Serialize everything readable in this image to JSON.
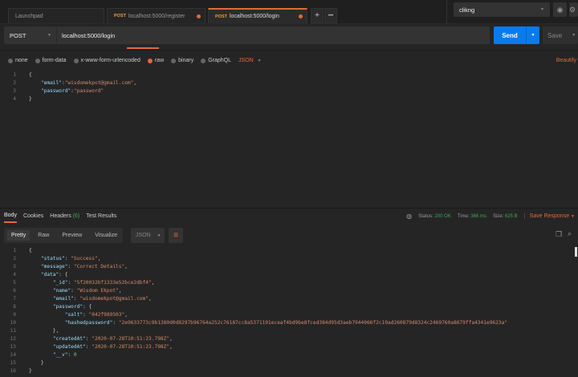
{
  "tabs": [
    {
      "label": "Launchpad"
    },
    {
      "method": "POST",
      "label": "localhost:5000/register",
      "unsaved": true
    },
    {
      "method": "POST",
      "label": "localhost:5000/login",
      "unsaved": true,
      "active": true
    }
  ],
  "tab_actions": {
    "new": "+",
    "more": "•••"
  },
  "environment": {
    "selected": "clikng"
  },
  "request": {
    "method": "POST",
    "url": "localhost:5000/login",
    "send_label": "Send",
    "save_label": "Save"
  },
  "body_options": {
    "items": [
      "none",
      "form-data",
      "x-www-form-urlencoded",
      "raw",
      "binary",
      "GraphQL"
    ],
    "selected": "raw",
    "format": "JSON",
    "beautify": "Beautify"
  },
  "request_body": [
    [
      {
        "t": "p",
        "v": "{"
      }
    ],
    [
      {
        "t": "p",
        "v": "    "
      },
      {
        "t": "k",
        "v": "\"email\""
      },
      {
        "t": "p",
        "v": ":"
      },
      {
        "t": "s",
        "v": "\"wisdomekpot@gmail.com\""
      },
      {
        "t": "p",
        "v": ","
      }
    ],
    [
      {
        "t": "p",
        "v": "    "
      },
      {
        "t": "k",
        "v": "\"password\""
      },
      {
        "t": "p",
        "v": ":"
      },
      {
        "t": "s",
        "v": "\"password\""
      }
    ],
    [
      {
        "t": "p",
        "v": "}"
      }
    ]
  ],
  "response": {
    "tabs": [
      "Body",
      "Cookies",
      "Headers",
      "Test Results"
    ],
    "headers_count": "(6)",
    "status_label": "Status:",
    "status": "200 OK",
    "time_label": "Time:",
    "time": "366 ms",
    "size_label": "Size:",
    "size": "625 B",
    "save_response": "Save Response",
    "view_modes": [
      "Pretty",
      "Raw",
      "Preview",
      "Visualize"
    ],
    "format": "JSON",
    "colors": {
      "accent": "#e4683a",
      "send": "#097bed",
      "ok": "#3fa854"
    }
  },
  "response_body": [
    [
      {
        "t": "p",
        "v": "{"
      }
    ],
    [
      {
        "t": "p",
        "v": "    "
      },
      {
        "t": "k",
        "v": "\"status\""
      },
      {
        "t": "p",
        "v": ": "
      },
      {
        "t": "s",
        "v": "\"Success\""
      },
      {
        "t": "p",
        "v": ","
      }
    ],
    [
      {
        "t": "p",
        "v": "    "
      },
      {
        "t": "k",
        "v": "\"message\""
      },
      {
        "t": "p",
        "v": ": "
      },
      {
        "t": "s",
        "v": "\"Correct Details\""
      },
      {
        "t": "p",
        "v": ","
      }
    ],
    [
      {
        "t": "p",
        "v": "    "
      },
      {
        "t": "k",
        "v": "\"data\""
      },
      {
        "t": "p",
        "v": ": {"
      }
    ],
    [
      {
        "t": "p",
        "v": "        "
      },
      {
        "t": "k",
        "v": "\"_id\""
      },
      {
        "t": "p",
        "v": ": "
      },
      {
        "t": "s",
        "v": "\"5f20032bf1333e52bce2dbf4\""
      },
      {
        "t": "p",
        "v": ","
      }
    ],
    [
      {
        "t": "p",
        "v": "        "
      },
      {
        "t": "k",
        "v": "\"name\""
      },
      {
        "t": "p",
        "v": ": "
      },
      {
        "t": "s",
        "v": "\"Wisdom Ekpot\""
      },
      {
        "t": "p",
        "v": ","
      }
    ],
    [
      {
        "t": "p",
        "v": "        "
      },
      {
        "t": "k",
        "v": "\"email\""
      },
      {
        "t": "p",
        "v": ": "
      },
      {
        "t": "s",
        "v": "\"wisdomekpot@gmail.com\""
      },
      {
        "t": "p",
        "v": ","
      }
    ],
    [
      {
        "t": "p",
        "v": "        "
      },
      {
        "t": "k",
        "v": "\"password\""
      },
      {
        "t": "p",
        "v": ": {"
      }
    ],
    [
      {
        "t": "p",
        "v": "            "
      },
      {
        "t": "k",
        "v": "\"salt\""
      },
      {
        "t": "p",
        "v": ": "
      },
      {
        "t": "s",
        "v": "\"042f989503\""
      },
      {
        "t": "p",
        "v": ","
      }
    ],
    [
      {
        "t": "p",
        "v": "            "
      },
      {
        "t": "k",
        "v": "\"hashedpassword\""
      },
      {
        "t": "p",
        "v": ": "
      },
      {
        "t": "s",
        "v": "\"2e9633773c9b1380d0d8297b96764a252c76187cc8a5371191eceaf4bd9be8fced384d95d3aeb7944066f2c19ad260879d8324c2469760a8679ffa4341e9623a\""
      }
    ],
    [
      {
        "t": "p",
        "v": "        },"
      }
    ],
    [
      {
        "t": "p",
        "v": "        "
      },
      {
        "t": "k",
        "v": "\"createdAt\""
      },
      {
        "t": "p",
        "v": ": "
      },
      {
        "t": "s",
        "v": "\"2020-07-28T10:51:23.798Z\""
      },
      {
        "t": "p",
        "v": ","
      }
    ],
    [
      {
        "t": "p",
        "v": "        "
      },
      {
        "t": "k",
        "v": "\"updatedAt\""
      },
      {
        "t": "p",
        "v": ": "
      },
      {
        "t": "s",
        "v": "\"2020-07-28T10:51:23.798Z\""
      },
      {
        "t": "p",
        "v": ","
      }
    ],
    [
      {
        "t": "p",
        "v": "        "
      },
      {
        "t": "k",
        "v": "\"__v\""
      },
      {
        "t": "p",
        "v": ": "
      },
      {
        "t": "n",
        "v": "0"
      }
    ],
    [
      {
        "t": "p",
        "v": "    }"
      }
    ],
    [
      {
        "t": "p",
        "v": "}"
      }
    ]
  ]
}
